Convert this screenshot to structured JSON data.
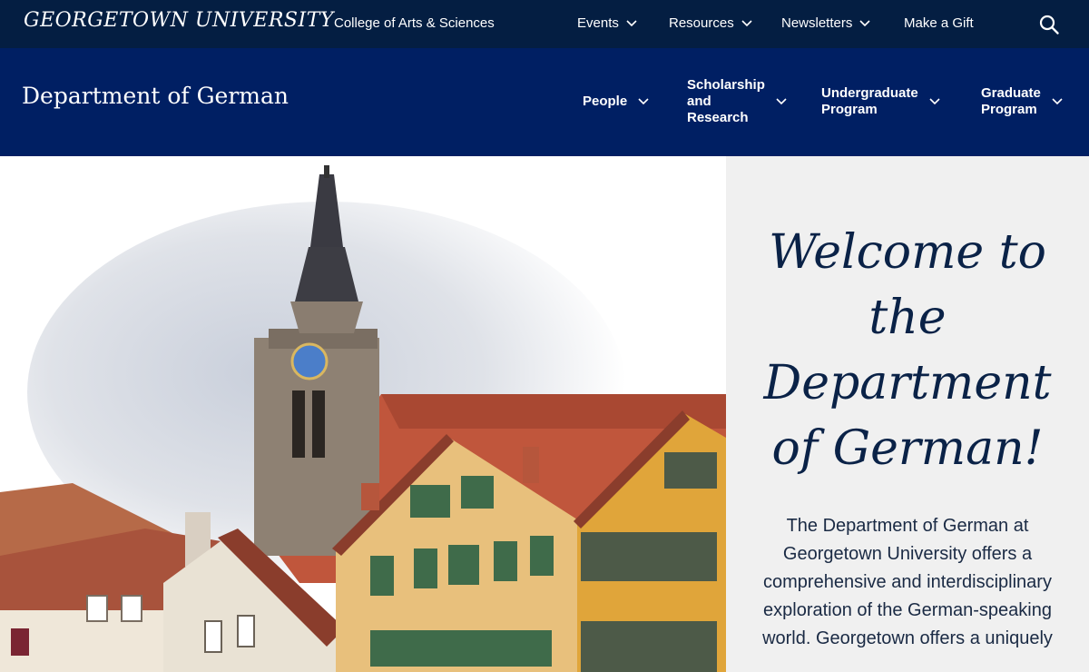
{
  "topbar": {
    "logo": "GEORGETOWN UNIVERSITY",
    "college": "College of Arts & Sciences",
    "nav": [
      {
        "label": "Events",
        "icon": "chevron-down-icon"
      },
      {
        "label": "Resources",
        "icon": "chevron-down-icon"
      },
      {
        "label": "Newsletters",
        "icon": "chevron-down-icon"
      },
      {
        "label": "Make a Gift"
      }
    ],
    "search_icon": "search-icon"
  },
  "dept": {
    "title": "Department of German",
    "nav": [
      {
        "label_lines": [
          "People"
        ]
      },
      {
        "label_lines": [
          "Scholarship",
          "and",
          "Research"
        ]
      },
      {
        "label_lines": [
          "Undergraduate",
          "Program"
        ]
      },
      {
        "label_lines": [
          "Graduate",
          "Program"
        ]
      }
    ]
  },
  "welcome": {
    "heading_lines": [
      "Welcome to",
      "the",
      "Department",
      "of German!"
    ],
    "body": "The Department of German at Georgetown University offers a comprehensive and interdisciplinary exploration of the German-speaking world. Georgetown offers a uniquely"
  },
  "colors": {
    "topbar_bg": "#041e42",
    "deptbar_bg": "#001f63",
    "panel_bg": "#f0f0f0",
    "heading_color": "#0a2247"
  }
}
